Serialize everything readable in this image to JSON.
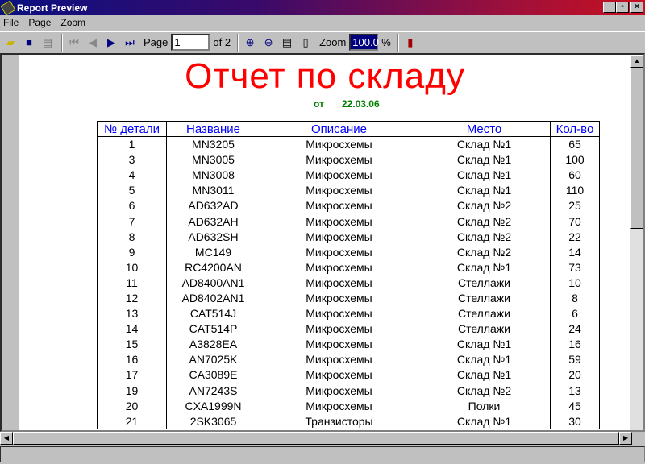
{
  "window": {
    "title": "Report Preview",
    "min": "_",
    "max": "▫",
    "close": "×"
  },
  "menu": [
    "File",
    "Page",
    "Zoom"
  ],
  "toolbar": {
    "page_label": "Page",
    "page_value": "1",
    "page_of": "of 2",
    "zoom_label": "Zoom",
    "zoom_value": "100.0",
    "percent": "%"
  },
  "report": {
    "title": "Отчет по складу",
    "date_prefix": "от",
    "date": "22.03.06",
    "columns": [
      "№ детали",
      "Название",
      "Описание",
      "Место",
      "Кол-во"
    ],
    "rows": [
      [
        "1",
        "MN3205",
        "Микросхемы",
        "Склад №1",
        "65"
      ],
      [
        "3",
        "MN3005",
        "Микросхемы",
        "Склад №1",
        "100"
      ],
      [
        "4",
        "MN3008",
        "Микросхемы",
        "Склад №1",
        "60"
      ],
      [
        "5",
        "MN3011",
        "Микросхемы",
        "Склад №1",
        "110"
      ],
      [
        "6",
        "AD632AD",
        "Микросхемы",
        "Склад №2",
        "25"
      ],
      [
        "7",
        "AD632AH",
        "Микросхемы",
        "Склад №2",
        "70"
      ],
      [
        "8",
        "AD632SH",
        "Микросхемы",
        "Склад №2",
        "22"
      ],
      [
        "9",
        "MC149",
        "Микросхемы",
        "Склад №2",
        "14"
      ],
      [
        "10",
        "RC4200AN",
        "Микросхемы",
        "Склад №1",
        "73"
      ],
      [
        "11",
        "AD8400AN1",
        "Микросхемы",
        "Стеллажи",
        "10"
      ],
      [
        "12",
        "AD8402AN1",
        "Микросхемы",
        "Стеллажи",
        "8"
      ],
      [
        "13",
        "CAT514J",
        "Микросхемы",
        "Стеллажи",
        "6"
      ],
      [
        "14",
        "CAT514P",
        "Микросхемы",
        "Стеллажи",
        "24"
      ],
      [
        "15",
        "A3828EA",
        "Микросхемы",
        "Склад №1",
        "16"
      ],
      [
        "16",
        "AN7025K",
        "Микросхемы",
        "Склад №1",
        "59"
      ],
      [
        "17",
        "CA3089E",
        "Микросхемы",
        "Склад №1",
        "20"
      ],
      [
        "19",
        "AN7243S",
        "Микросхемы",
        "Склад №2",
        "13"
      ],
      [
        "20",
        "CXA1999N",
        "Микросхемы",
        "Полки",
        "45"
      ],
      [
        "21",
        "2SK3065",
        "Транзисторы",
        "Склад №1",
        "30"
      ]
    ]
  }
}
